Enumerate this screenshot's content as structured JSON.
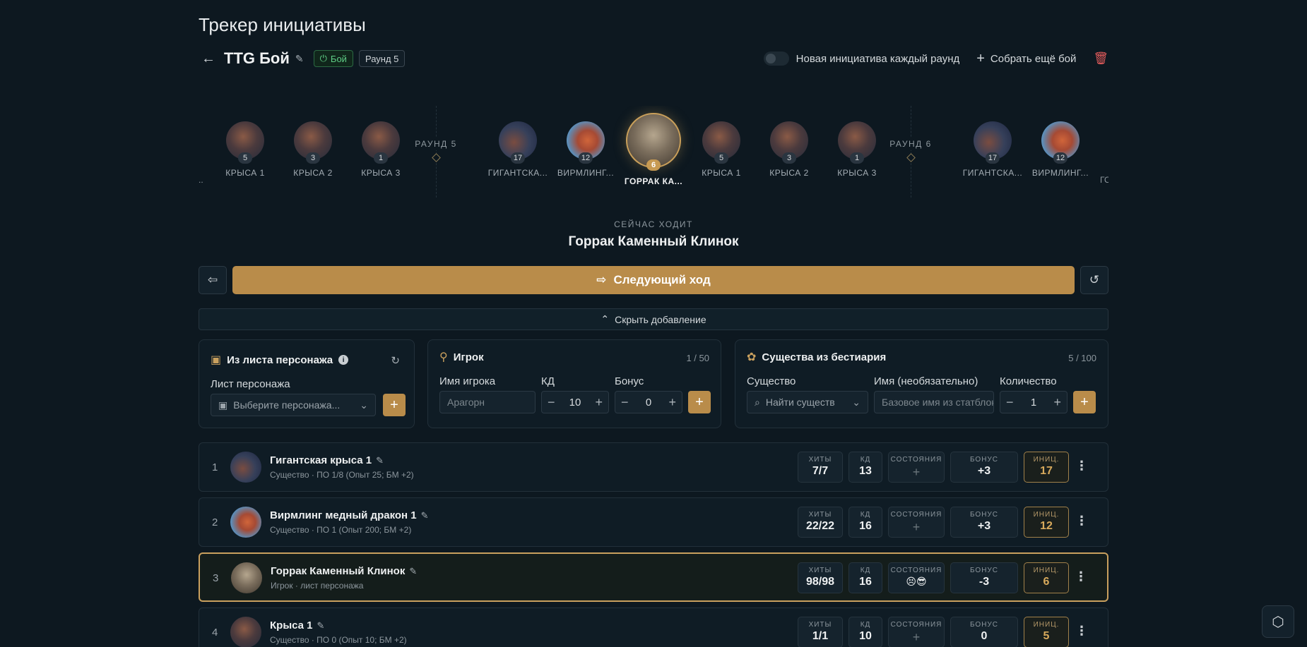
{
  "page_title": "Трекер инициативы",
  "encounter": {
    "name": "TTG Бой",
    "status_badge": "Бой",
    "round_badge": "Раунд 5"
  },
  "header_actions": {
    "toggle_label": "Новая инициатива каждый раунд",
    "add_encounter": "Собрать ещё бой"
  },
  "timeline": {
    "round_labels": [
      "РАУНД 5",
      "РАУНД 6"
    ],
    "items": [
      {
        "label": "..",
        "init": ""
      },
      {
        "label": "КРЫСА 1",
        "init": "5"
      },
      {
        "label": "КРЫСА 2",
        "init": "3"
      },
      {
        "label": "КРЫСА 3",
        "init": "1"
      },
      {
        "label": "ГИГАНТСКА...",
        "init": "17"
      },
      {
        "label": "ВИРМЛИНГ...",
        "init": "12"
      },
      {
        "label": "ГОРРАК КА...",
        "init": "6"
      },
      {
        "label": "КРЫСА 1",
        "init": "5"
      },
      {
        "label": "КРЫСА 2",
        "init": "3"
      },
      {
        "label": "КРЫСА 3",
        "init": "1"
      },
      {
        "label": "ГИГАНТСКА...",
        "init": "17"
      },
      {
        "label": "ВИРМЛИНГ...",
        "init": "12"
      },
      {
        "label": "ГС",
        "init": ""
      }
    ]
  },
  "current_turn": {
    "label": "СЕЙЧАС ХОДИТ",
    "name": "Горрак Каменный Клинок"
  },
  "next_turn_button": "Следующий ход",
  "collapse_label": "Скрыть добавление",
  "panels": {
    "sheet": {
      "title": "Из листа персонажа",
      "field_label": "Лист персонажа",
      "placeholder": "Выберите персонажа..."
    },
    "player": {
      "title": "Игрок",
      "count": "1 / 50",
      "name_label": "Имя игрока",
      "name_placeholder": "Арагорн",
      "ac_label": "КД",
      "ac_value": "10",
      "bonus_label": "Бонус",
      "bonus_value": "0"
    },
    "bestiary": {
      "title": "Существа из бестиария",
      "count": "5 / 100",
      "creature_label": "Существо",
      "creature_placeholder": "Найти существо",
      "name_label": "Имя (необязательно)",
      "name_placeholder": "Базовое имя из статблока",
      "qty_label": "Количество",
      "qty_value": "1"
    }
  },
  "stat_labels": {
    "hp": "ХИТЫ",
    "ac": "КД",
    "conditions": "СОСТОЯНИЯ",
    "bonus": "БОНУС",
    "init": "ИНИЦ."
  },
  "combatants": [
    {
      "num": "1",
      "name": "Гигантская крыса 1",
      "sub": "Существо · ПО 1/8 (Опыт 25; БМ +2)",
      "hp": "7/7",
      "ac": "13",
      "conditions": "+",
      "bonus": "+3",
      "init": "17"
    },
    {
      "num": "2",
      "name": "Вирмлинг медный дракон 1",
      "sub": "Существо · ПО 1 (Опыт 200; БМ +2)",
      "hp": "22/22",
      "ac": "16",
      "conditions": "+",
      "bonus": "+3",
      "init": "12"
    },
    {
      "num": "3",
      "name": "Горрак Каменный Клинок",
      "sub": "Игрок · лист персонажа",
      "hp": "98/98",
      "ac": "16",
      "conditions": "😣😎",
      "bonus": "-3",
      "init": "6"
    },
    {
      "num": "4",
      "name": "Крыса 1",
      "sub": "Существо · ПО 0 (Опыт 10; БМ +2)",
      "hp": "1/1",
      "ac": "10",
      "conditions": "+",
      "bonus": "0",
      "init": "5"
    }
  ]
}
